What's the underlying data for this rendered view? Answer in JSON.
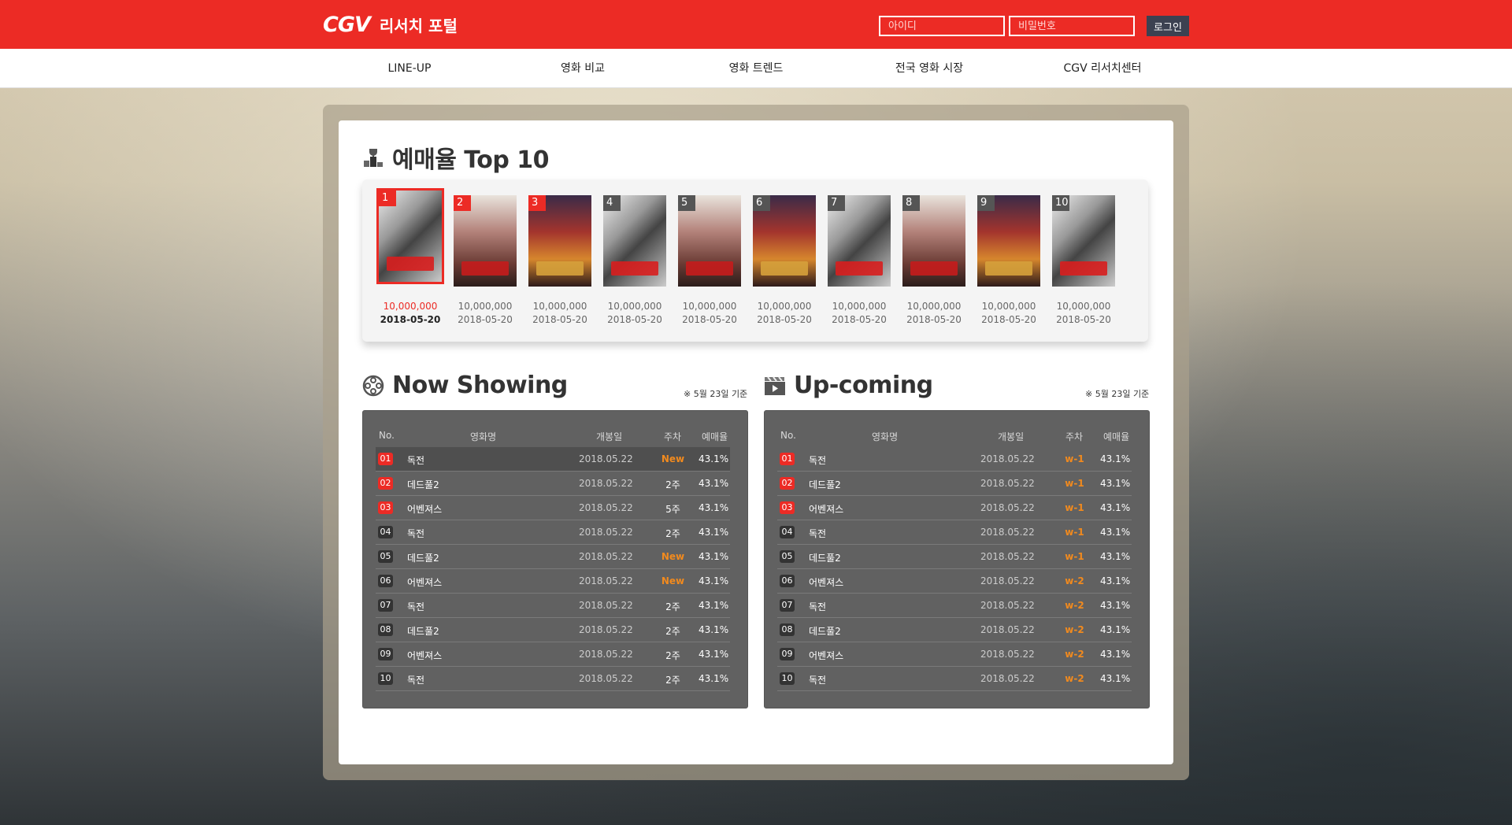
{
  "header": {
    "logo_brand": "CGV",
    "logo_text": "리서치 포털",
    "id_placeholder": "아이디",
    "pw_placeholder": "비밀번호",
    "login_label": "로그인"
  },
  "nav": [
    "LINE-UP",
    "영화 비교",
    "영화 트렌드",
    "전국 영화 시장",
    "CGV 리서치센터"
  ],
  "top10": {
    "title": "예매율 Top 10",
    "icon": "trophy-podium-icon",
    "items": [
      {
        "rank": "1",
        "poster": "dokjeon",
        "amount": "10,000,000",
        "date": "2018-05-20"
      },
      {
        "rank": "2",
        "poster": "deadpool2",
        "amount": "10,000,000",
        "date": "2018-05-20"
      },
      {
        "rank": "3",
        "poster": "avengers",
        "amount": "10,000,000",
        "date": "2018-05-20"
      },
      {
        "rank": "4",
        "poster": "dokjeon",
        "amount": "10,000,000",
        "date": "2018-05-20"
      },
      {
        "rank": "5",
        "poster": "deadpool2",
        "amount": "10,000,000",
        "date": "2018-05-20"
      },
      {
        "rank": "6",
        "poster": "avengers",
        "amount": "10,000,000",
        "date": "2018-05-20"
      },
      {
        "rank": "7",
        "poster": "dokjeon",
        "amount": "10,000,000",
        "date": "2018-05-20"
      },
      {
        "rank": "8",
        "poster": "deadpool2",
        "amount": "10,000,000",
        "date": "2018-05-20"
      },
      {
        "rank": "9",
        "poster": "avengers",
        "amount": "10,000,000",
        "date": "2018-05-20"
      },
      {
        "rank": "10",
        "poster": "dokjeon",
        "amount": "10,000,000",
        "date": "2018-05-20"
      }
    ]
  },
  "now_showing": {
    "title": "Now Showing",
    "icon": "film-reel-icon",
    "note": "※ 5월 23일 기준",
    "columns": [
      "No.",
      "영화명",
      "개봉일",
      "주차",
      "예매율"
    ],
    "rows": [
      {
        "no": "01",
        "name": "독전",
        "date": "2018.05.22",
        "week": "New",
        "rate": "43.1%"
      },
      {
        "no": "02",
        "name": "데드풀2",
        "date": "2018.05.22",
        "week": "2주",
        "rate": "43.1%"
      },
      {
        "no": "03",
        "name": "어벤져스",
        "date": "2018.05.22",
        "week": "5주",
        "rate": "43.1%"
      },
      {
        "no": "04",
        "name": "독전",
        "date": "2018.05.22",
        "week": "2주",
        "rate": "43.1%"
      },
      {
        "no": "05",
        "name": "데드풀2",
        "date": "2018.05.22",
        "week": "New",
        "rate": "43.1%"
      },
      {
        "no": "06",
        "name": "어벤져스",
        "date": "2018.05.22",
        "week": "New",
        "rate": "43.1%"
      },
      {
        "no": "07",
        "name": "독전",
        "date": "2018.05.22",
        "week": "2주",
        "rate": "43.1%"
      },
      {
        "no": "08",
        "name": "데드풀2",
        "date": "2018.05.22",
        "week": "2주",
        "rate": "43.1%"
      },
      {
        "no": "09",
        "name": "어벤져스",
        "date": "2018.05.22",
        "week": "2주",
        "rate": "43.1%"
      },
      {
        "no": "10",
        "name": "독전",
        "date": "2018.05.22",
        "week": "2주",
        "rate": "43.1%"
      }
    ]
  },
  "upcoming": {
    "title": "Up-coming",
    "icon": "clapperboard-icon",
    "note": "※ 5월 23일 기준",
    "columns": [
      "No.",
      "영화명",
      "개봉일",
      "주차",
      "예매율"
    ],
    "rows": [
      {
        "no": "01",
        "name": "독전",
        "date": "2018.05.22",
        "week": "w-1",
        "rate": "43.1%"
      },
      {
        "no": "02",
        "name": "데드풀2",
        "date": "2018.05.22",
        "week": "w-1",
        "rate": "43.1%"
      },
      {
        "no": "03",
        "name": "어벤져스",
        "date": "2018.05.22",
        "week": "w-1",
        "rate": "43.1%"
      },
      {
        "no": "04",
        "name": "독전",
        "date": "2018.05.22",
        "week": "w-1",
        "rate": "43.1%"
      },
      {
        "no": "05",
        "name": "데드풀2",
        "date": "2018.05.22",
        "week": "w-1",
        "rate": "43.1%"
      },
      {
        "no": "06",
        "name": "어벤져스",
        "date": "2018.05.22",
        "week": "w-2",
        "rate": "43.1%"
      },
      {
        "no": "07",
        "name": "독전",
        "date": "2018.05.22",
        "week": "w-2",
        "rate": "43.1%"
      },
      {
        "no": "08",
        "name": "데드풀2",
        "date": "2018.05.22",
        "week": "w-2",
        "rate": "43.1%"
      },
      {
        "no": "09",
        "name": "어벤져스",
        "date": "2018.05.22",
        "week": "w-2",
        "rate": "43.1%"
      },
      {
        "no": "10",
        "name": "독전",
        "date": "2018.05.22",
        "week": "w-2",
        "rate": "43.1%"
      }
    ]
  },
  "colors": {
    "brand_red": "#ec2b25",
    "accent_orange": "#f18a1e",
    "panel_gray": "#616161"
  }
}
